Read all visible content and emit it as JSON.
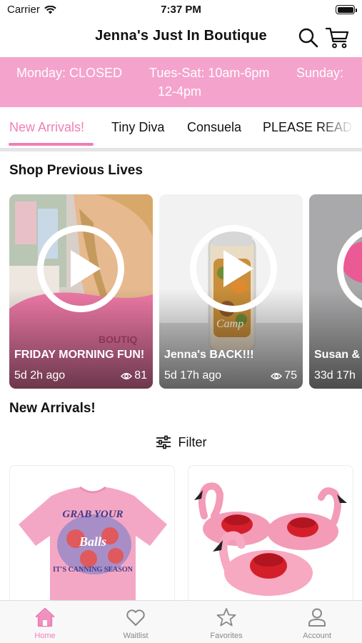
{
  "status_bar": {
    "carrier": "Carrier",
    "time": "7:37 PM"
  },
  "header": {
    "title": "Jenna's Just In Boutique",
    "icons": [
      "search-icon",
      "cart-icon"
    ]
  },
  "hours_banner": {
    "line1_a": "Monday: CLOSED",
    "line1_b": "Tues-Sat: 10am-6pm",
    "line1_c": "Sunday:",
    "line2": "12-4pm"
  },
  "tabs": [
    {
      "label": "New Arrivals!",
      "active": true
    },
    {
      "label": "Tiny Diva",
      "active": false
    },
    {
      "label": "Consuela",
      "active": false
    },
    {
      "label": "PLEASE READ",
      "active": false
    }
  ],
  "previous_lives": {
    "title": "Shop Previous Lives",
    "items": [
      {
        "caption": "FRIDAY MORNING FUN!",
        "age": "5d 2h ago",
        "views": "81"
      },
      {
        "caption": "Jenna's BACK!!!",
        "age": "5d 17h ago",
        "views": "75"
      },
      {
        "caption": "Susan & THIRSTY",
        "age": "33d 17h",
        "views": ""
      }
    ]
  },
  "new_arrivals": {
    "title": "New Arrivals!",
    "filter_label": "Filter",
    "products": [
      {
        "image": "pink-tshirt",
        "shirt_text_1": "GRAB YOUR",
        "shirt_text_2": "Balls",
        "shirt_text_3": "IT'S CANNING SEASON"
      },
      {
        "image": "flamingo-drink-floats"
      }
    ]
  },
  "bottom_nav": [
    {
      "label": "Home",
      "icon": "home-icon",
      "active": true
    },
    {
      "label": "Waitlist",
      "icon": "heart-icon",
      "active": false
    },
    {
      "label": "Favorites",
      "icon": "star-icon",
      "active": false
    },
    {
      "label": "Account",
      "icon": "account-icon",
      "active": false
    }
  ],
  "colors": {
    "accent": "#ef7fb6",
    "banner": "#f4a3cc",
    "inactive": "#888888"
  }
}
